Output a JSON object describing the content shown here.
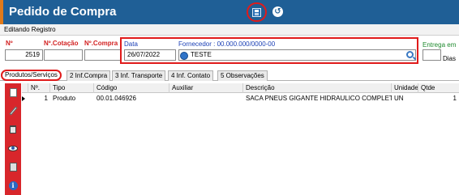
{
  "title_bar": {
    "title": "Pedido de Compra"
  },
  "status": {
    "text": "Editando Registro"
  },
  "header": {
    "numero_label": "Nº",
    "numero_value": "2519",
    "cotacao_label": "Nº.Cotação",
    "compra_label": "Nº.Compra",
    "data_label": "Data",
    "data_value": "26/07/2022",
    "fornecedor_label": "Fornecedor : 00.000.000/0000-00",
    "fornecedor_value": "TESTE",
    "entrega_label": "Entrega em",
    "dias_label": "Dias"
  },
  "tabs": [
    {
      "label": "Produtos/Serviços"
    },
    {
      "label": "2 Inf.Compra"
    },
    {
      "label": "3 Inf. Transporte"
    },
    {
      "label": "4 Inf. Contato"
    },
    {
      "label": "5 Observações"
    }
  ],
  "table": {
    "columns": [
      "Nº.",
      "Tipo",
      "Código",
      "Auxiliar",
      "Descrição",
      "Unidade",
      "Qtde"
    ],
    "rows": [
      {
        "numero": "1",
        "tipo": "Produto",
        "codigo": "00.01.046926",
        "auxiliar": "",
        "descricao": "SACA PNEUS GIGANTE HIDRAULICO COMPLETO",
        "unidade": "UN",
        "qtde": "1"
      }
    ]
  },
  "toolbar_icons": [
    "new-document-icon",
    "edit-pencil-icon",
    "delete-trash-icon",
    "view-eye-icon",
    "calculator-icon",
    "info-icon"
  ],
  "colors": {
    "title_bar": "#1f5f96",
    "accent_orange": "#e07a1a",
    "highlight_red": "#e01b1b",
    "sidebar_red": "#d8262b",
    "label_blue": "#1a3fb5",
    "label_green": "#1e8a2e"
  }
}
